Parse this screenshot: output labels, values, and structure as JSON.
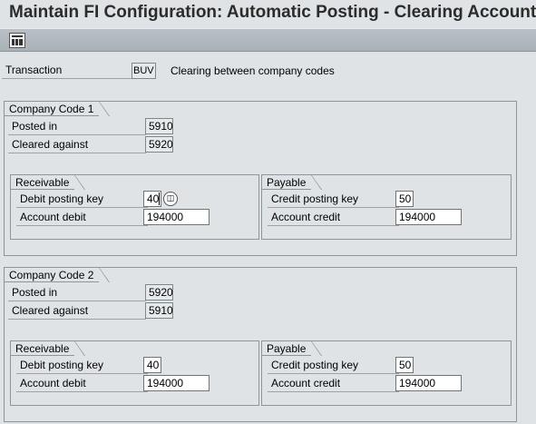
{
  "window": {
    "title": "Maintain FI Configuration: Automatic Posting - Clearing Accounts"
  },
  "toolbar": {
    "icon": "table-view-icon"
  },
  "transaction": {
    "label": "Transaction",
    "value": "BUV",
    "description": "Clearing between company codes"
  },
  "company_code_1": {
    "title": "Company Code 1",
    "posted_in_label": "Posted in",
    "posted_in_value": "5910",
    "cleared_against_label": "Cleared against",
    "cleared_against_value": "5920",
    "receivable": {
      "title": "Receivable",
      "debit_key_label": "Debit posting key",
      "debit_key_value": "40",
      "account_debit_label": "Account debit",
      "account_debit_value": "194000"
    },
    "payable": {
      "title": "Payable",
      "credit_key_label": "Credit posting key",
      "credit_key_value": "50",
      "account_credit_label": "Account credit",
      "account_credit_value": "194000"
    }
  },
  "company_code_2": {
    "title": "Company Code 2",
    "posted_in_label": "Posted in",
    "posted_in_value": "5920",
    "cleared_against_label": "Cleared against",
    "cleared_against_value": "5910",
    "receivable": {
      "title": "Receivable",
      "debit_key_label": "Debit posting key",
      "debit_key_value": "40",
      "account_debit_label": "Account debit",
      "account_debit_value": "194000"
    },
    "payable": {
      "title": "Payable",
      "credit_key_label": "Credit posting key",
      "credit_key_value": "50",
      "account_credit_label": "Account credit",
      "account_credit_value": "194000"
    }
  }
}
